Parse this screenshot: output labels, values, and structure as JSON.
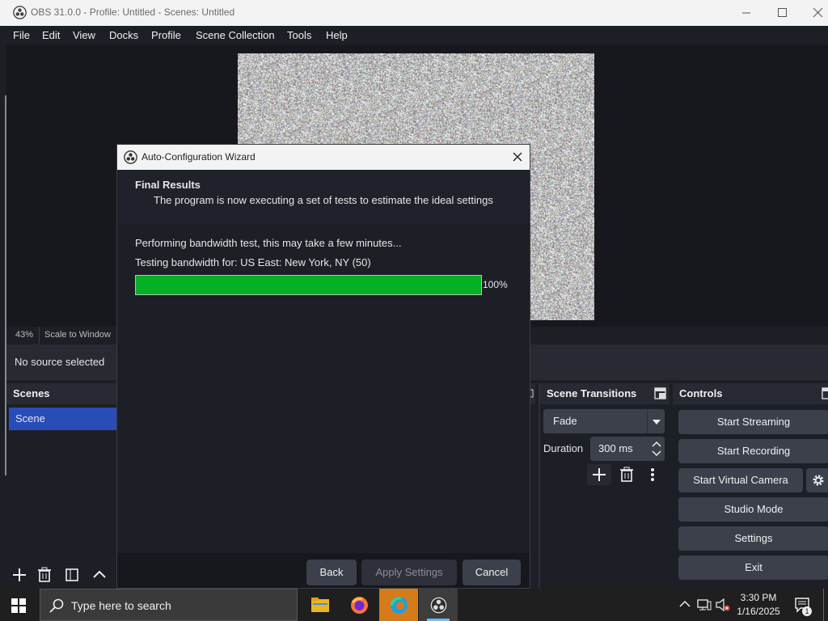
{
  "window": {
    "title": "OBS 31.0.0 - Profile: Untitled - Scenes: Untitled"
  },
  "menu": [
    "File",
    "Edit",
    "View",
    "Docks",
    "Profile",
    "Scene Collection",
    "Tools",
    "Help"
  ],
  "preview": {
    "zoom": "43%",
    "scale_mode": "Scale to Window",
    "no_source": "No source selected"
  },
  "scenes": {
    "title": "Scenes",
    "items": [
      "Scene"
    ]
  },
  "transitions": {
    "title": "Scene Transitions",
    "selected": "Fade",
    "duration_label": "Duration",
    "duration_value": "300 ms"
  },
  "controls": {
    "title": "Controls",
    "buttons": [
      "Start Streaming",
      "Start Recording",
      "Start Virtual Camera",
      "Studio Mode",
      "Settings",
      "Exit"
    ]
  },
  "dialog": {
    "title": "Auto-Configuration Wizard",
    "header_title": "Final Results",
    "header_subtitle": "The program is now executing a set of tests to estimate the ideal settings",
    "status": "Performing bandwidth test, this may take a few minutes...",
    "testing": "Testing bandwidth for: US East: New York, NY (50)",
    "progress": 1.0,
    "progress_label": "100%",
    "progress_color": "#06b025",
    "buttons": {
      "back": "Back",
      "apply": "Apply Settings",
      "cancel": "Cancel"
    }
  },
  "taskbar": {
    "search_placeholder": "Type here to search",
    "time": "3:30 PM",
    "date": "1/16/2025",
    "notification_count": "1"
  },
  "colors": {
    "accent": "#284cb8",
    "background": "#1d1f26",
    "button": "#3c404b"
  }
}
